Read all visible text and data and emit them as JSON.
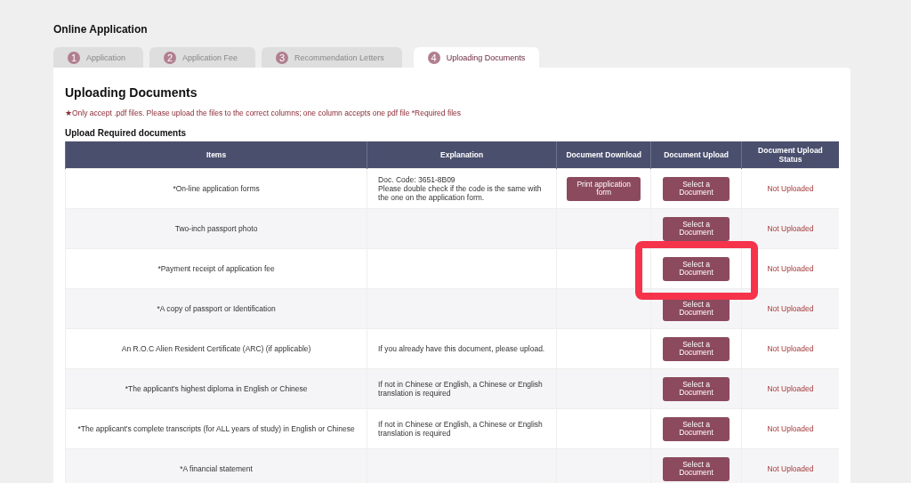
{
  "page_title": "Online Application",
  "tabs": [
    {
      "number": "1",
      "label": "Application",
      "selected": false
    },
    {
      "number": "2",
      "label": "Application Fee",
      "selected": false
    },
    {
      "number": "3",
      "label": "Recommendation Letters",
      "selected": false
    },
    {
      "number": "4",
      "label": "Uploading Documents",
      "selected": true
    }
  ],
  "section_title": "Uploading Documents",
  "notice": {
    "star": "★",
    "text": "Only accept .pdf files. Please upload the files to the correct columns; one column accepts one pdf file *Required files"
  },
  "table_title": "Upload Required documents",
  "table": {
    "columns": [
      "Items",
      "Explanation",
      "Document Download",
      "Document Upload",
      "Document Upload Status"
    ],
    "rows": [
      {
        "item": "*On-line application forms",
        "explanation": "Doc. Code: 3651-8B09\nPlease double check if the code is the same with the one on the application form.",
        "download": "Print application form",
        "upload": "Select a Document",
        "status": "Not Uploaded",
        "highlighted": false
      },
      {
        "item": "Two-inch passport photo",
        "upload": "Select a Document",
        "status": "Not Uploaded",
        "highlighted": false
      },
      {
        "item": "*Payment receipt of application fee",
        "upload": "Select a Document",
        "status": "Not Uploaded",
        "highlighted": true
      },
      {
        "item": "*A copy of passport or Identification",
        "upload": "Select a Document",
        "status": "Not Uploaded",
        "highlighted": false
      },
      {
        "item": "An R.O.C Alien Resident Certificate (ARC) (if applicable)",
        "explanation": "If you already have this document, please upload.",
        "upload": "Select a Document",
        "status": "Not Uploaded",
        "highlighted": false
      },
      {
        "item": "*The applicant's highest diploma in English or Chinese",
        "explanation": "If not in Chinese or English, a Chinese or English translation is required",
        "upload": "Select a Document",
        "status": "Not Uploaded",
        "highlighted": false
      },
      {
        "item": "*The applicant's complete transcripts (for ALL years of study) in English or Chinese",
        "explanation": "If not in Chinese or English, a Chinese or English translation is required",
        "upload": "Select a Document",
        "status": "Not Uploaded",
        "highlighted": false
      },
      {
        "item": "*A financial statement",
        "upload": "Select a Document",
        "status": "Not Uploaded",
        "highlighted": false
      }
    ]
  }
}
